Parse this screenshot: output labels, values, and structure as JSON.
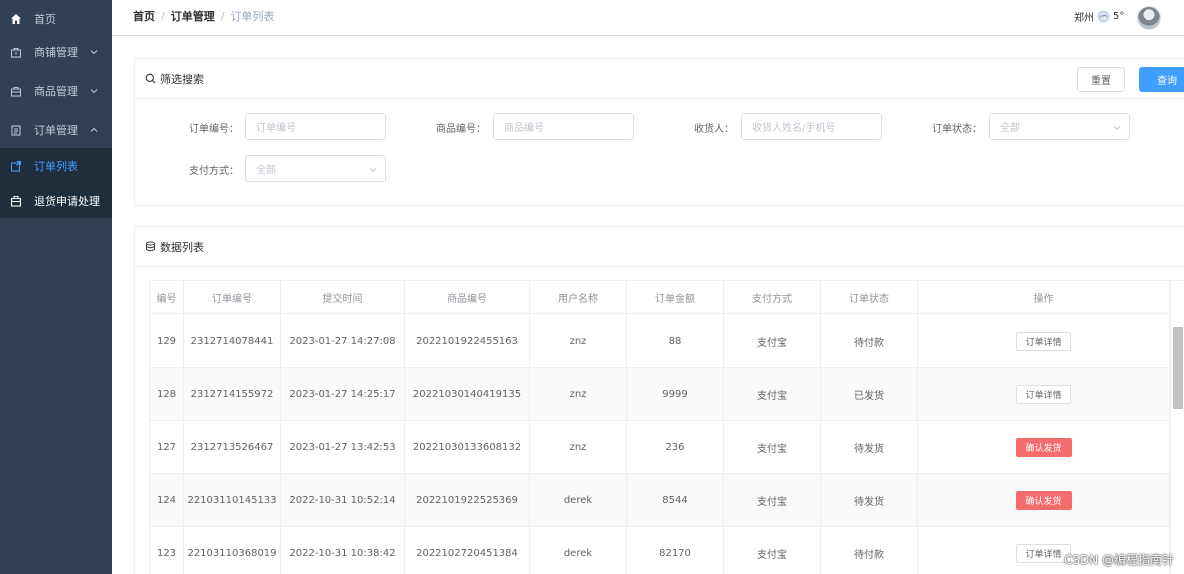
{
  "sidebar": {
    "items": [
      {
        "label": "首页"
      },
      {
        "label": "商铺管理"
      },
      {
        "label": "商品管理"
      },
      {
        "label": "订单管理"
      },
      {
        "label": "订单列表"
      },
      {
        "label": "退货申请处理"
      }
    ]
  },
  "breadcrumb": [
    "首页",
    "订单管理",
    "订单列表"
  ],
  "breadcrumb_sep": "/",
  "weather": {
    "city": "郑州",
    "temp": "5°"
  },
  "filter": {
    "title": "筛选搜索",
    "reset_label": "重置",
    "query_label": "查询",
    "fields": [
      {
        "label": "订单编号：",
        "placeholder": "订单编号"
      },
      {
        "label": "商品编号：",
        "placeholder": "商品编号"
      },
      {
        "label": "收货人：",
        "placeholder": "收货人姓名/手机号"
      },
      {
        "label": "订单状态：",
        "placeholder": "全部"
      },
      {
        "label": "支付方式：",
        "placeholder": "全部"
      }
    ]
  },
  "data_list": {
    "title": "数据列表",
    "columns": [
      "编号",
      "订单编号",
      "提交时间",
      "商品编号",
      "用户名称",
      "订单金额",
      "支付方式",
      "订单状态",
      "操作"
    ],
    "rows": [
      {
        "id": "129",
        "order_no": "2312714078441",
        "time": "2023-01-27 14:27:08",
        "product_no": "2022101922455163",
        "user": "znz",
        "amount": "88",
        "pay": "支付宝",
        "status": "待付款",
        "action": "订单详情",
        "action_type": "detail"
      },
      {
        "id": "128",
        "order_no": "2312714155972",
        "time": "2023-01-27 14:25:17",
        "product_no": "20221030140419135",
        "user": "znz",
        "amount": "9999",
        "pay": "支付宝",
        "status": "已发货",
        "action": "订单详情",
        "action_type": "detail"
      },
      {
        "id": "127",
        "order_no": "2312713526467",
        "time": "2023-01-27 13:42:53",
        "product_no": "20221030133608132",
        "user": "znz",
        "amount": "236",
        "pay": "支付宝",
        "status": "待发货",
        "action": "确认发货",
        "action_type": "ship"
      },
      {
        "id": "124",
        "order_no": "22103110145133",
        "time": "2022-10-31 10:52:14",
        "product_no": "2022101922525369",
        "user": "derek",
        "amount": "8544",
        "pay": "支付宝",
        "status": "待发货",
        "action": "确认发货",
        "action_type": "ship"
      },
      {
        "id": "123",
        "order_no": "22103110368019",
        "time": "2022-10-31 10:38:42",
        "product_no": "2022102720451384",
        "user": "derek",
        "amount": "82170",
        "pay": "支付宝",
        "status": "待付款",
        "action": "订单详情",
        "action_type": "detail"
      }
    ]
  },
  "watermark": "CSDN @编程指南针",
  "colors": {
    "sidebar_bg": "#304156",
    "active": "#409eff",
    "primary": "#409eff",
    "danger": "#f56c6c"
  }
}
